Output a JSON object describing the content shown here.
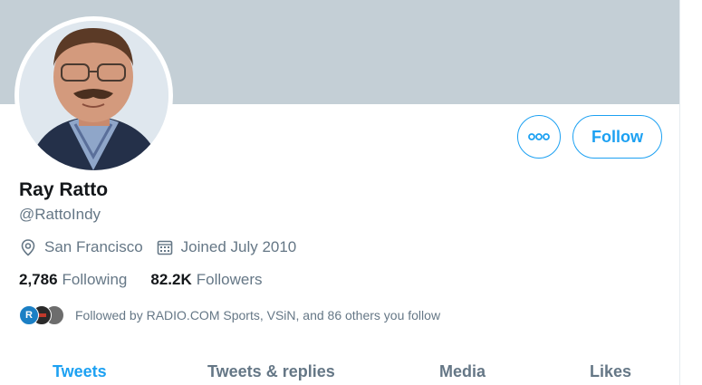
{
  "profile": {
    "name": "Ray Ratto",
    "handle": "@RattoIndy",
    "location": "San Francisco",
    "joined": "Joined July 2010",
    "following_count": "2,786",
    "following_label": "Following",
    "followers_count": "82.2K",
    "followers_label": "Followers",
    "followed_by": "Followed by RADIO.COM Sports, VSiN, and 86 others you follow",
    "followed_by_avatars": [
      "R",
      "V",
      ""
    ]
  },
  "actions": {
    "follow_label": "Follow",
    "more_icon": "more-icon"
  },
  "tabs": [
    {
      "label": "Tweets",
      "active": true
    },
    {
      "label": "Tweets & replies",
      "active": false
    },
    {
      "label": "Media",
      "active": false
    },
    {
      "label": "Likes",
      "active": false
    }
  ],
  "colors": {
    "accent": "#1da1f2",
    "banner": "#c4cfd6",
    "text_primary": "#14171a",
    "text_secondary": "#657786"
  }
}
